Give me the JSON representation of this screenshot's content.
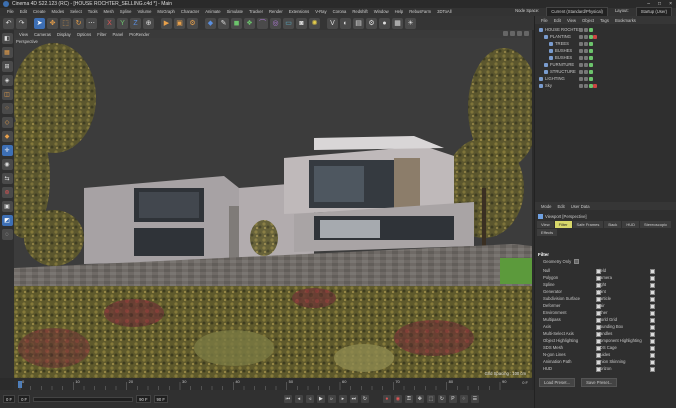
{
  "title": "Cinema 4D S22.123 (RC) - [HOUSE ROCHTER_SELLING.c4d *] - Main",
  "menubar": {
    "items": [
      "File",
      "Edit",
      "Create",
      "Modes",
      "Select",
      "Tools",
      "Mesh",
      "Spline",
      "Volume",
      "MoGraph",
      "Character",
      "Animate",
      "Simulate",
      "Tracker",
      "Render",
      "Extensions",
      "V-Ray",
      "Corona",
      "Redshift",
      "Window",
      "Help",
      "RebusFarm",
      "3DToAll"
    ],
    "node_spaces_label": "Node Space:",
    "node_space_value": "Current (Standard/Physical)",
    "layout_label": "Layout:",
    "layout_value": "Startup (User)"
  },
  "viewport": {
    "menu": [
      "View",
      "Cameras",
      "Display",
      "Options",
      "Filter",
      "Panel",
      "ProRender"
    ],
    "camera_label": "Perspective",
    "grid_spacing": "Grid Spacing : 100 cm"
  },
  "timeline": {
    "ticks": [
      "0",
      "10",
      "20",
      "30",
      "40",
      "50",
      "60",
      "70",
      "80",
      "90"
    ],
    "end_tick": "0 F"
  },
  "playbar": {
    "start_frame": "0 F",
    "current_frame": "0 F",
    "end_frame": "90 F",
    "end_frame2": "90 F"
  },
  "object_manager": {
    "menu": [
      "File",
      "Edit",
      "View",
      "Object",
      "Tags",
      "Bookmarks"
    ],
    "objects": [
      {
        "name": "HOUSE ROCHTER",
        "indent": 0
      },
      {
        "name": "PLANTING",
        "indent": 1
      },
      {
        "name": "TREES",
        "indent": 2
      },
      {
        "name": "BUSHES",
        "indent": 2
      },
      {
        "name": "BUSHES",
        "indent": 2
      },
      {
        "name": "FURNITURE",
        "indent": 1
      },
      {
        "name": "STRUCTURE",
        "indent": 1
      },
      {
        "name": "LIGHTING",
        "indent": 0
      },
      {
        "name": "Sky",
        "indent": 0
      }
    ]
  },
  "attributes": {
    "menu": [
      "Mode",
      "Edit",
      "User Data"
    ],
    "header": "Viewport [Perspective]",
    "tabs": [
      {
        "label": "View",
        "active": false
      },
      {
        "label": "Filter",
        "active": true
      },
      {
        "label": "Safe Frames",
        "active": false
      },
      {
        "label": "Back",
        "active": false
      },
      {
        "label": "HUD",
        "active": false
      },
      {
        "label": "Stereoscopic",
        "active": false
      },
      {
        "label": "Effects",
        "active": false
      }
    ],
    "section": "Filter",
    "geometry_only": "Geometry Only",
    "left_col": [
      "Null",
      "Polygon",
      "Spline",
      "Generator",
      "Subdivision Surface",
      "Deformer",
      "Environment",
      "Multipass",
      "Axis",
      "Multi-Select Axis",
      "Object Highlighting",
      "SDS Mesh",
      "N-gon Lines",
      "Animation Path",
      "HUD"
    ],
    "right_col": [
      "Field",
      "Camera",
      "Light",
      "Joint",
      "Particle",
      "Hair",
      "Other",
      "World Grid",
      "Bounding Box",
      "Handles",
      "Component Highlighting",
      "SDS Cage",
      "Guides",
      "Onion Skinning",
      "Horizon"
    ],
    "buttons": [
      "Load Preset...",
      "Save Preset..."
    ]
  }
}
